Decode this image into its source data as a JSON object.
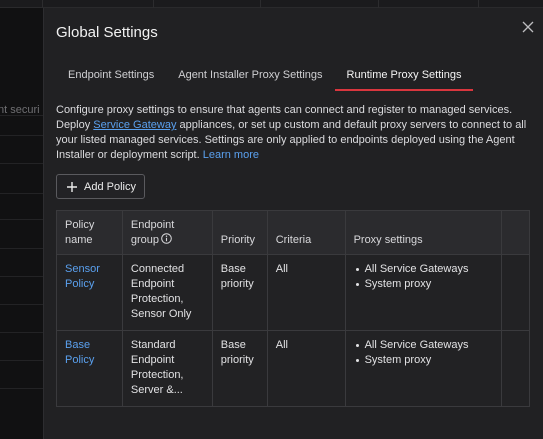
{
  "background": {
    "left_truncated_text": "nt securi"
  },
  "modal": {
    "title": "Global Settings",
    "tabs": [
      {
        "label": "Endpoint Settings",
        "active": false
      },
      {
        "label": "Agent Installer Proxy Settings",
        "active": false
      },
      {
        "label": "Runtime Proxy Settings",
        "active": true
      }
    ],
    "description": {
      "part1": "Configure proxy settings to ensure that agents can connect and register to managed services. Deploy ",
      "link1": "Service Gateway",
      "part2": " appliances, or set up custom and default proxy servers to connect to all your listed managed services. Settings are only applied to endpoints deployed using the Agent Installer or deployment script. ",
      "link2": "Learn more"
    },
    "add_button": "Add Policy",
    "table": {
      "headers": {
        "policy_name": "Policy name",
        "endpoint_group": "Endpoint group",
        "priority": "Priority",
        "criteria": "Criteria",
        "proxy_settings": "Proxy settings"
      },
      "rows": [
        {
          "policy_name": "Sensor Policy",
          "endpoint_group": "Connected Endpoint Protection, Sensor Only",
          "priority": "Base priority",
          "criteria": "All",
          "proxy": [
            "All Service Gateways",
            "System proxy"
          ]
        },
        {
          "policy_name": "Base Policy",
          "endpoint_group": "Standard Endpoint Protection, Server &...",
          "priority": "Base priority",
          "criteria": "All",
          "proxy": [
            "All Service Gateways",
            "System proxy"
          ]
        }
      ]
    }
  },
  "colors": {
    "accent_tab_underline": "#d9363e",
    "link": "#5aa0ee",
    "modal_bg": "#212123"
  }
}
